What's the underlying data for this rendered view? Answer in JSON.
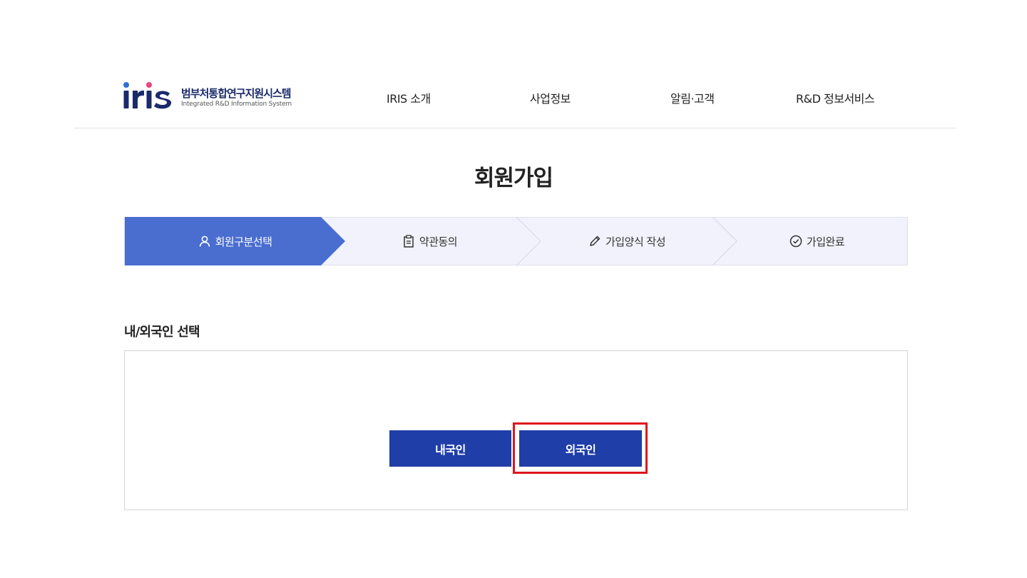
{
  "header": {
    "logo_mark": "iris",
    "logo_title": "범부처통합연구지원시스템",
    "logo_subtitle": "Integrated R&D Information System",
    "nav": [
      {
        "label": "IRIS 소개"
      },
      {
        "label": "사업정보"
      },
      {
        "label": "알림·고객"
      },
      {
        "label": "R&D 정보서비스"
      }
    ]
  },
  "page": {
    "title": "회원가입"
  },
  "steps": [
    {
      "label": "회원구분선택",
      "icon": "user-icon",
      "active": true
    },
    {
      "label": "약관동의",
      "icon": "clipboard-icon",
      "active": false
    },
    {
      "label": "가입양식 작성",
      "icon": "pencil-icon",
      "active": false
    },
    {
      "label": "가입완료",
      "icon": "check-circle-icon",
      "active": false
    }
  ],
  "selection": {
    "title": "내/외국인 선택",
    "native_label": "내국인",
    "foreign_label": "외국인"
  },
  "colors": {
    "active_step": "#4a6dd0",
    "step_bg": "#f1f2fb",
    "button": "#1f3ea8",
    "highlight": "#e1141c",
    "logo_navy": "#1b2a6b",
    "logo_pink": "#e8467c",
    "logo_blue": "#2f6fd6"
  }
}
